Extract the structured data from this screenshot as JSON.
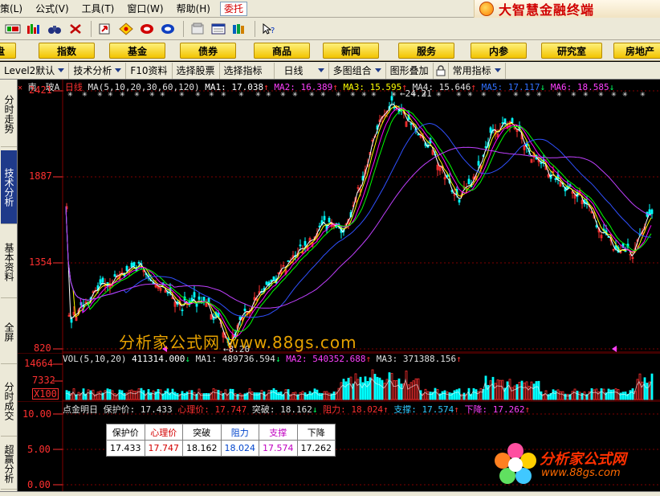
{
  "menubar": {
    "items": [
      "策(L)",
      "公式(V)",
      "工具(T)",
      "窗口(W)",
      "帮助(H)"
    ],
    "entrust_label": "委托",
    "brand": "大智慧金融终端"
  },
  "toolbar": {
    "icons": [
      "chart-icon",
      "multi-chart-icon",
      "binoculars-icon",
      "cross-icon",
      "red-arrow-icon",
      "yellow-diamond-icon",
      "red-circle-icon",
      "blue-circle-icon",
      "page-icon",
      "window-icon",
      "books-icon",
      "help-cursor-icon"
    ]
  },
  "sections": {
    "tabs": [
      "盘",
      "指数",
      "基金",
      "债券",
      "商品",
      "新闻",
      "服务",
      "内参",
      "研究室",
      "房地产"
    ]
  },
  "funcbar": {
    "level2": "Level2默认",
    "tech": "技术分析",
    "f10": "F10资料",
    "select_stock": "选择股票",
    "select_indicator": "选择指标",
    "period": "日线",
    "multi_combo": "多图组合",
    "overlay": "图形叠加",
    "common_indicator": "常用指标"
  },
  "lefttabs": {
    "items": [
      "分时走势",
      "技术分析",
      "基本资料",
      "全屏",
      "分时成交",
      "超赢分析"
    ]
  },
  "price_panel": {
    "header": {
      "stock": "南　玻A",
      "period": "日线",
      "ma_label": "MA(5,10,20,30,60,120)",
      "ma1": "MA1: 17.038",
      "ma1_arrow": "↑",
      "ma2": "MA2: 16.389",
      "ma2_arrow": "↑",
      "ma3": "MA3: 15.595",
      "ma3_arrow": "↑",
      "ma4": "MA4: 15.646",
      "ma4_arrow": "↑",
      "ma5": "MA5: 17.117",
      "ma5_arrow": "↓",
      "ma6": "MA6: 18.585",
      "ma6_arrow": "↓"
    },
    "y_ticks": [
      "2421",
      "1887",
      "1354",
      "820"
    ],
    "high_label": "24.21",
    "low_label": "8.20"
  },
  "volume_panel": {
    "header": {
      "label": "VOL(5,10,20)",
      "vol": "411314.000",
      "vol_arrow": "↓",
      "ma1": "MA1: 489736.594",
      "ma1_arrow": "↓",
      "ma2": "MA2: 540352.688",
      "ma2_arrow": "↑",
      "ma3": "MA3: 371388.156",
      "ma3_arrow": "↑"
    },
    "y_ticks": [
      "14664",
      "7332",
      "X100"
    ]
  },
  "indicator_panel": {
    "header": {
      "name": "点金明日",
      "protect": "保护价: 17.433",
      "mental": "心理价: 17.747",
      "break": "突破: 18.162",
      "break_arrow": "↓",
      "resist": "阻力: 18.024",
      "resist_arrow": "↑",
      "support": "支撑: 17.574",
      "support_arrow": "↑",
      "drop": "下降: 17.262",
      "drop_arrow": "↑"
    },
    "y_ticks": [
      "10.00",
      "5.00",
      "0.00"
    ],
    "table": {
      "headers": [
        "保护价",
        "心理价",
        "突破",
        "阻力",
        "支撑",
        "下降"
      ],
      "values": [
        "17.433",
        "17.747",
        "18.162",
        "18.024",
        "17.574",
        "17.262"
      ],
      "colors": [
        "#000000",
        "#d40000",
        "#000000",
        "#0044cc",
        "#c000c0",
        "#000000"
      ]
    }
  },
  "watermark": {
    "text": "分析家公式网 www.88gs.com",
    "corner_brand": "分析家公式网",
    "corner_url": "www.88gs.com"
  },
  "colors": {
    "up": "#ff3030",
    "down": "#00ffff",
    "ma5": "#ffffff",
    "ma10": "#ffff00",
    "ma20": "#ff00ff",
    "ma30": "#00ff00",
    "ma60": "#3050ff",
    "ma120": "#c040ff",
    "grid": "#800000"
  }
}
